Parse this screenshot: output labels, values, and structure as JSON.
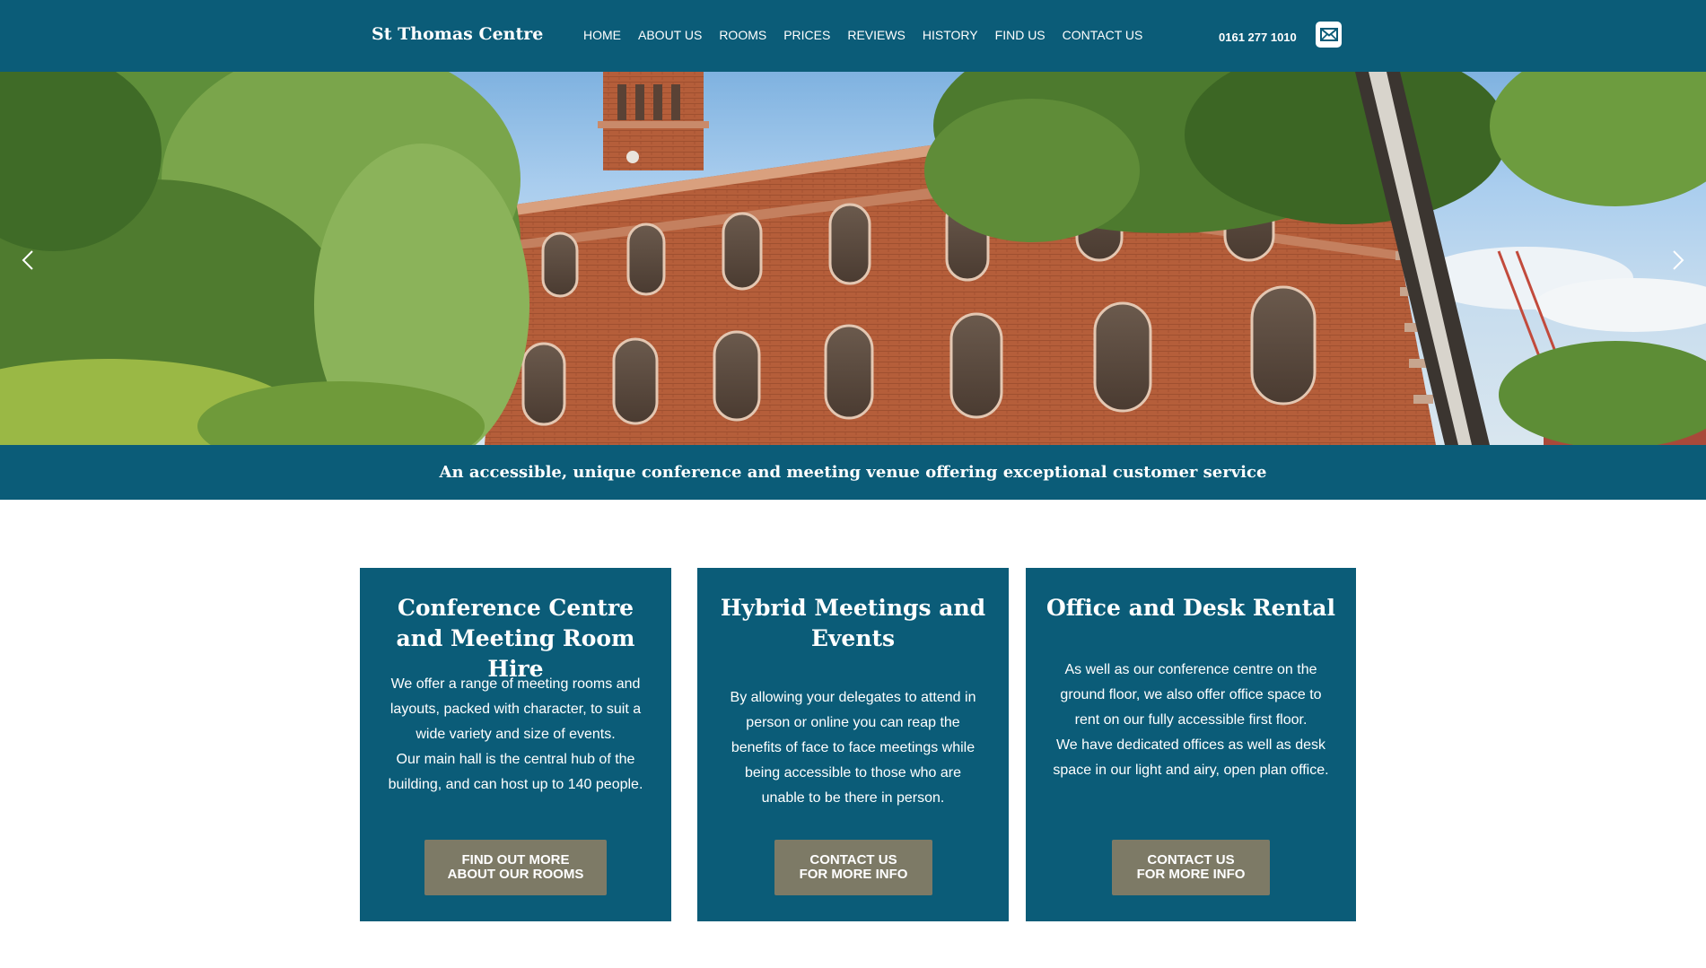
{
  "colors": {
    "brand_teal": "#0b5c78",
    "button_khaki": "#7d7a66",
    "brick": "#b35f3c"
  },
  "header": {
    "logo": "St Thomas Centre",
    "nav": [
      "HOME",
      "ABOUT US",
      "ROOMS",
      "PRICES",
      "REVIEWS",
      "HISTORY",
      "FIND US",
      "CONTACT US"
    ],
    "phone": "0161 277 1010",
    "mail_icon": "envelope-icon"
  },
  "hero": {
    "prev_icon": "chevron-left-icon",
    "next_icon": "chevron-right-icon"
  },
  "tagline": "An accessible, unique conference and meeting venue offering exceptional customer service",
  "cards": [
    {
      "title": "Conference Centre and Meeting Room Hire",
      "body": [
        "We offer a range of meeting rooms and layouts, packed with character, to suit a wide variety and size of events.",
        "Our main hall is the central hub of the building, and can host up to 140 people."
      ],
      "button": "FIND OUT MORE\nABOUT OUR ROOMS"
    },
    {
      "title": "Hybrid Meetings and Events",
      "body": [
        "By allowing your delegates to attend in person or online you can reap the benefits of face to face meetings while being accessible to those who are unable to be there in person."
      ],
      "button": "CONTACT US\nFOR MORE INFO"
    },
    {
      "title": "Office and Desk Rental",
      "body": [
        "As well as our conference centre on the ground floor, we also offer office space to rent on our fully accessible first floor.",
        "We have dedicated offices as well as desk space in our light and airy, open plan office."
      ],
      "button": "CONTACT US\nFOR MORE INFO"
    }
  ]
}
